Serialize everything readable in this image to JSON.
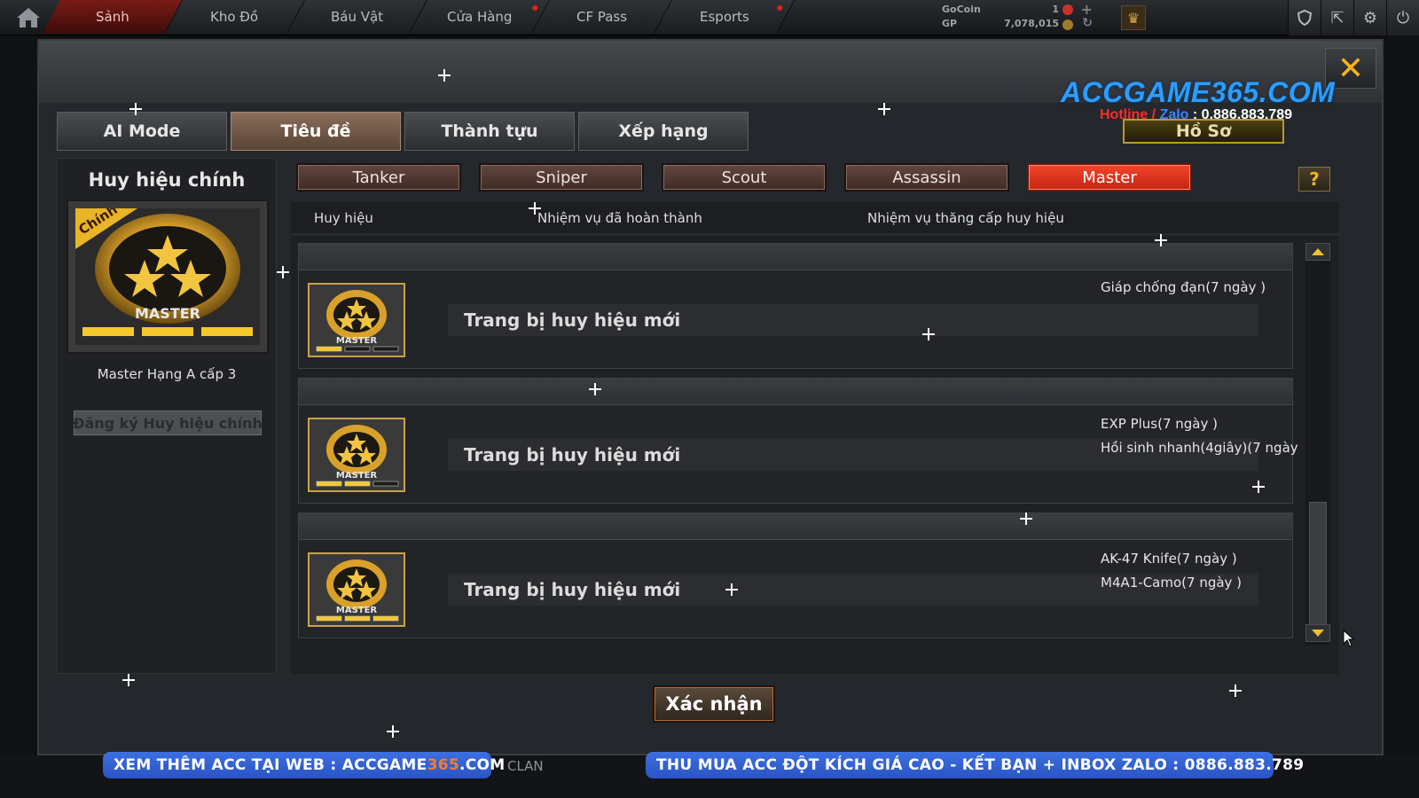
{
  "nav": {
    "tabs": [
      {
        "label": "Sảnh",
        "active": true,
        "alert": false
      },
      {
        "label": "Kho Đồ",
        "active": false,
        "alert": false
      },
      {
        "label": "Báu Vật",
        "active": false,
        "alert": false
      },
      {
        "label": "Cửa Hàng",
        "active": false,
        "alert": true
      },
      {
        "label": "CF Pass",
        "active": false,
        "alert": false
      },
      {
        "label": "Esports",
        "active": false,
        "alert": true
      }
    ],
    "currency": {
      "gocoin_label": "GoCoin",
      "gocoin_value": "1",
      "gp_label": "GP",
      "gp_value": "7,078,015"
    },
    "right_icons": [
      "shield-icon",
      "exit-icon",
      "gear-icon",
      "power-icon"
    ]
  },
  "watermark": {
    "title": "ACCGAME365.COM",
    "hotline_label": "Hotline",
    "separator": " / ",
    "zalo_label": "Zalo",
    "phone": " : 0.886.883.789"
  },
  "modal": {
    "main_tabs": [
      {
        "label": "AI Mode",
        "active": false
      },
      {
        "label": "Tiêu đề",
        "active": true
      },
      {
        "label": "Thành tựu",
        "active": false
      },
      {
        "label": "Xếp hạng",
        "active": false
      }
    ],
    "profile_button": "Hồ Sơ",
    "left_panel": {
      "title": "Huy hiệu chính",
      "corner_tag": "Chính",
      "badge_label": "MASTER",
      "rank_text": "Master Hạng A cấp 3",
      "register_button": "Đăng ký Huy hiệu chính"
    },
    "class_tabs": [
      {
        "label": "Tanker",
        "active": false
      },
      {
        "label": "Sniper",
        "active": false
      },
      {
        "label": "Scout",
        "active": false
      },
      {
        "label": "Assassin",
        "active": false
      },
      {
        "label": "Master",
        "active": true
      }
    ],
    "help_label": "?",
    "columns": [
      "Huy hiệu",
      "Nhiệm vụ đã hoàn thành",
      "Nhiệm vụ thăng cấp huy hiệu"
    ],
    "rows": [
      {
        "badge": "MASTER",
        "task": "Trang bị huy hiệu mới",
        "rewards": [
          "Giáp chống đạn(7 ngày )"
        ],
        "level_filled": 1
      },
      {
        "badge": "MASTER",
        "task": "Trang bị huy hiệu mới",
        "rewards": [
          "EXP Plus(7 ngày )",
          "Hồi sinh nhanh(4giây)(7 ngày"
        ],
        "level_filled": 2
      },
      {
        "badge": "MASTER",
        "task": "Trang bị huy hiệu mới",
        "rewards": [
          "AK-47 Knife(7 ngày )",
          "M4A1-Camo(7 ngày )"
        ],
        "level_filled": 3
      }
    ],
    "confirm_button": "Xác nhận",
    "close_icon": "close-icon"
  },
  "bottom": {
    "left_banner_prefix": "XEM THÊM ACC TẠI WEB : ACCGAME",
    "left_banner_highlight": "365",
    "left_banner_suffix": ".COM",
    "right_banner": "THU MUA ACC ĐỘT KÍCH GIÁ CAO - KẾT BẠN + INBOX ZALO : 0886.883.789",
    "clan_label": "CLAN"
  },
  "colors": {
    "accent_active_tab": "#e0341d",
    "badge_gold": "#d9a12a",
    "watermark_blue": "#2b9dff",
    "banner_blue": "#2f5ed4"
  }
}
